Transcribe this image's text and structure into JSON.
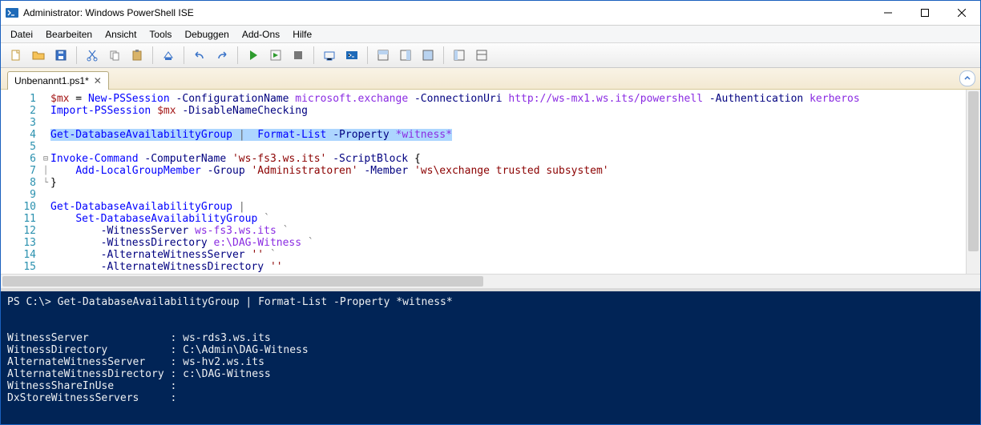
{
  "window": {
    "title": "Administrator: Windows PowerShell ISE"
  },
  "menu": {
    "items": [
      "Datei",
      "Bearbeiten",
      "Ansicht",
      "Tools",
      "Debuggen",
      "Add-Ons",
      "Hilfe"
    ]
  },
  "tab": {
    "label": "Unbenannt1.ps1*"
  },
  "editor": {
    "line_count": 15
  },
  "code_tokens": {
    "l1": {
      "var": "$mx",
      "eq": " = ",
      "cmd": "New-PSSession",
      "p1": " -ConfigurationName ",
      "a1": "microsoft.exchange",
      "p2": " -ConnectionUri ",
      "a2": "http://ws-mx1.ws.its/powershell",
      "p3": " -Authentication ",
      "a3": "kerberos"
    },
    "l2": {
      "cmd": "Import-PSSession ",
      "var": "$mx",
      "p1": " -DisableNameChecking"
    },
    "l4": {
      "cmd1": "Get-DatabaseAvailabilityGroup ",
      "pipe": "| ",
      "cmd2": " Format-List ",
      "p1": "-Property ",
      "a1": "*witness*"
    },
    "l6": {
      "cmd": "Invoke-Command",
      "p1": " -ComputerName ",
      "s1": "'ws-fs3.ws.its'",
      "p2": " -ScriptBlock ",
      "b": "{"
    },
    "l7": {
      "pad": "    ",
      "cmd": "Add-LocalGroupMember",
      "p1": " -Group ",
      "s1": "'Administratoren'",
      "p2": " -Member ",
      "s2": "'ws\\exchange trusted subsystem'"
    },
    "l8": {
      "b": "}"
    },
    "l10": {
      "cmd": "Get-DatabaseAvailabilityGroup ",
      "pipe": "|"
    },
    "l11": {
      "pad": "    ",
      "cmd": "Set-DatabaseAvailabilityGroup ",
      "tick": "`"
    },
    "l12": {
      "pad": "        ",
      "p": "-WitnessServer ",
      "a": "ws-fs3.ws.its ",
      "tick": "`"
    },
    "l13": {
      "pad": "        ",
      "p": "-WitnessDirectory ",
      "a": "e:\\DAG-Witness ",
      "tick": "`"
    },
    "l14": {
      "pad": "        ",
      "p": "-AlternateWitnessServer ",
      "s": "'' ",
      "tick": "`"
    },
    "l15": {
      "pad": "        ",
      "p": "-AlternateWitnessDirectory ",
      "s": "''"
    }
  },
  "console": {
    "prompt": "PS C:\\> ",
    "command": "Get-DatabaseAvailabilityGroup | Format-List -Property *witness*",
    "output_lines": [
      "WitnessServer             : ws-rds3.ws.its",
      "WitnessDirectory          : C:\\Admin\\DAG-Witness",
      "AlternateWitnessServer    : ws-hv2.ws.its",
      "AlternateWitnessDirectory : c:\\DAG-Witness",
      "WitnessShareInUse         :",
      "DxStoreWitnessServers     :"
    ]
  }
}
